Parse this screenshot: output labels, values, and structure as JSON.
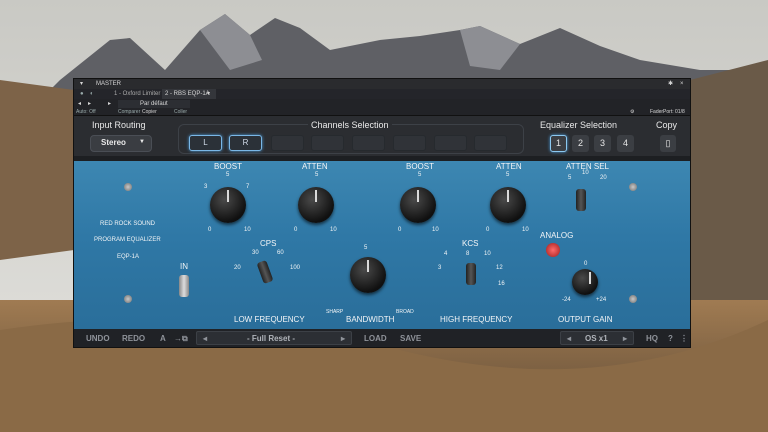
{
  "window": {
    "tb1_title": "MASTER",
    "tb1_pin": "✱",
    "tb1_close": "×",
    "tabs": [
      "1 - Oxford Limiter",
      "2 - RBS EQP-1A"
    ],
    "tab_caret": "▾",
    "row3_preset": "Par défaut",
    "row3_left_small": "Auto: Off",
    "row3_items": [
      "Comparer",
      "Copier",
      "Coller"
    ],
    "faderport": "FaderPort: 01/8"
  },
  "header": {
    "input_routing": "Input Routing",
    "routing_value": "Stereo",
    "channels_selection": "Channels Selection",
    "equalizer_selection": "Equalizer Selection",
    "copy": "Copy",
    "channel_buttons": [
      "L",
      "R"
    ],
    "eq_buttons": [
      "1",
      "2",
      "3",
      "4"
    ]
  },
  "panel": {
    "brand_line1": "RED ROCK SOUND",
    "brand_line2": "PROGRAM EQUALIZER",
    "brand_line3": "EQP-1A",
    "boost1": "BOOST",
    "atten1": "ATTEN",
    "boost2": "BOOST",
    "atten2": "ATTEN",
    "atten_sel": "ATTEN SEL",
    "cps": "CPS",
    "kcs": "KCS",
    "analog": "ANALOG",
    "in": "IN",
    "low_frequency": "LOW FREQUENCY",
    "bandwidth": "BANDWIDTH",
    "sharp": "SHARP",
    "broad": "BROAD",
    "high_frequency": "HIGH FREQUENCY",
    "output_gain": "OUTPUT GAIN",
    "knob_scale": [
      "0",
      "1",
      "2",
      "3",
      "4",
      "5",
      "6",
      "7",
      "8",
      "9",
      "10"
    ],
    "atten_sel_scale": [
      "5",
      "10",
      "20"
    ],
    "cps_scale": [
      "20",
      "30",
      "60",
      "100"
    ],
    "kcs_scale": [
      "3",
      "4",
      "5",
      "8",
      "10",
      "12",
      "16"
    ],
    "output_scale": [
      "-24",
      "0",
      "+24"
    ]
  },
  "bottom": {
    "undo": "UNDO",
    "redo": "REDO",
    "a_label": "A",
    "preset": "- Full Reset -",
    "load": "LOAD",
    "save": "SAVE",
    "os": "OS x1",
    "hq": "HQ",
    "help": "?"
  },
  "colors": {
    "panel_blue": "#3182b0",
    "window_dark": "#1d1f22",
    "accent": "#7ab7e6"
  }
}
